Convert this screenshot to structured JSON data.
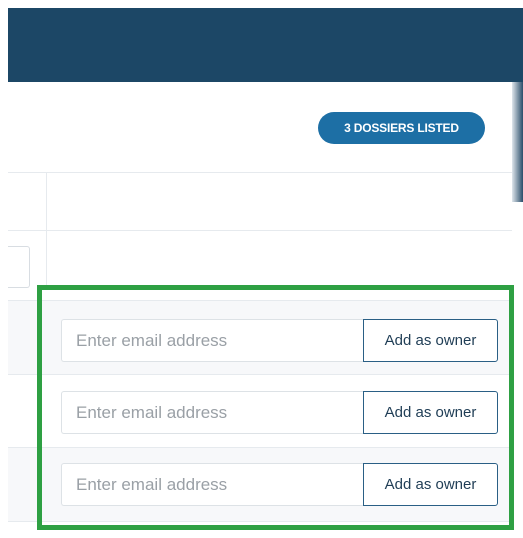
{
  "header": {
    "badge_label": "3 DOSSIERS LISTED"
  },
  "owner_rows": [
    {
      "email_placeholder": "Enter email address",
      "button_label": "Add as owner"
    },
    {
      "email_placeholder": "Enter email address",
      "button_label": "Add as owner"
    },
    {
      "email_placeholder": "Enter email address",
      "button_label": "Add as owner"
    }
  ],
  "colors": {
    "topbar": "#1c4766",
    "badge": "#1d6fa5",
    "highlight": "#2ea043",
    "button_border": "#2a5f85"
  }
}
